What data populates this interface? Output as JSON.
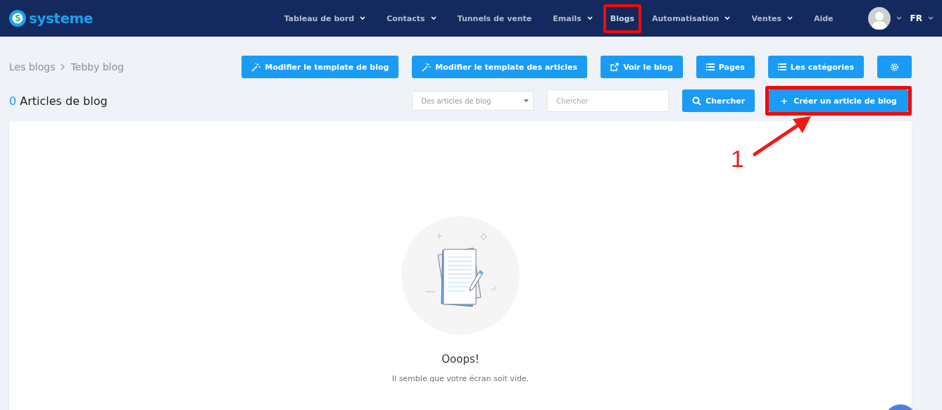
{
  "logo": {
    "text": "systeme"
  },
  "nav": {
    "items": [
      {
        "label": "Tableau de bord",
        "dropdown": true,
        "highlighted": false
      },
      {
        "label": "Contacts",
        "dropdown": true,
        "highlighted": false
      },
      {
        "label": "Tunnels de vente",
        "dropdown": false,
        "highlighted": false
      },
      {
        "label": "Emails",
        "dropdown": true,
        "highlighted": false
      },
      {
        "label": "Blogs",
        "dropdown": false,
        "highlighted": true
      },
      {
        "label": "Automatisation",
        "dropdown": true,
        "highlighted": false
      },
      {
        "label": "Ventes",
        "dropdown": true,
        "highlighted": false
      },
      {
        "label": "Aide",
        "dropdown": false,
        "highlighted": false
      }
    ],
    "language": "FR"
  },
  "breadcrumb": [
    "Les blogs",
    "Tebby blog"
  ],
  "toolbar": [
    {
      "label": "Modifier le template de blog",
      "kind": "wand"
    },
    {
      "label": "Modifier le template des articles",
      "kind": "wand"
    },
    {
      "label": "Voir le blog",
      "kind": "external"
    },
    {
      "label": "Pages",
      "kind": "list"
    },
    {
      "label": "Les catégories",
      "kind": "list"
    },
    {
      "kind": "settings"
    }
  ],
  "heading": {
    "count": "0",
    "title": "Articles de blog"
  },
  "filter": {
    "placeholder": "Des articles de blog"
  },
  "search": {
    "placeholder": "Chercher",
    "button": "Chercher"
  },
  "create_button": {
    "label": "Créer un article de blog",
    "icon": "+",
    "highlighted": true
  },
  "empty_state": {
    "title": "Ooops!",
    "message": "Il semble que votre écran soit vide."
  },
  "annotation": {
    "label": "1"
  }
}
